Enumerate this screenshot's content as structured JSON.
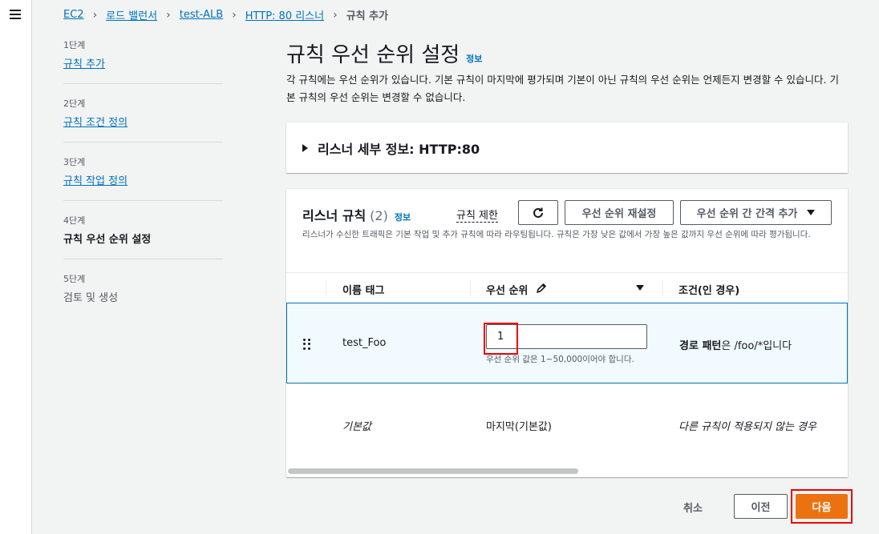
{
  "breadcrumb": [
    "EC2",
    "로드 밸런서",
    "test-ALB",
    "HTTP: 80 리스너",
    "규칙 추가"
  ],
  "steps": [
    {
      "num": "1단계",
      "label": "규칙 추가"
    },
    {
      "num": "2단계",
      "label": "규칙 조건 정의"
    },
    {
      "num": "3단계",
      "label": "규칙 작업 정의"
    },
    {
      "num": "4단계",
      "label": "규칙 우선 순위 설정"
    },
    {
      "num": "5단계",
      "label": "검토 및 생성"
    }
  ],
  "page": {
    "title": "규칙 우선 순위 설정",
    "info": "정보",
    "description": "각 규칙에는 우선 순위가 있습니다. 기본 규칙이 마지막에 평가되며 기본이 아닌 규칙의 우선 순위는 언제든지 변경할 수 있습니다. 기본 규칙의 우선 순위는 변경할 수 없습니다."
  },
  "listener_details": {
    "label": "리스너 세부 정보: HTTP:80"
  },
  "rules_panel": {
    "title": "리스너 규칙",
    "count": "(2)",
    "info": "정보",
    "limit": "규칙 제한",
    "reset_button": "우선 순위 재설정",
    "gap_button": "우선 순위 간 간격 추가",
    "description": "리스너가 수신한 트래픽은 기본 작업 및 추가 규칙에 따라 라우팅됩니다. 규칙은 가장 낮은 값에서 가장 높은 값까지 우선 순위에 따라 평가됩니다.",
    "columns": {
      "name": "이름 태그",
      "priority": "우선 순위",
      "condition": "조건(인 경우)"
    },
    "rows": [
      {
        "name": "test_Foo",
        "priority_value": "1",
        "hint": "우선 순위 값은 1~50,000이어야 합니다.",
        "cond_bold": "경로 패턴",
        "cond_rest": "은 /foo/*입니다"
      },
      {
        "name": "기본값",
        "priority": "마지막(기본값)",
        "condition": "다른 규칙이 적용되지 않는 경우"
      }
    ]
  },
  "footer": {
    "cancel": "취소",
    "prev": "이전",
    "next": "다음"
  }
}
